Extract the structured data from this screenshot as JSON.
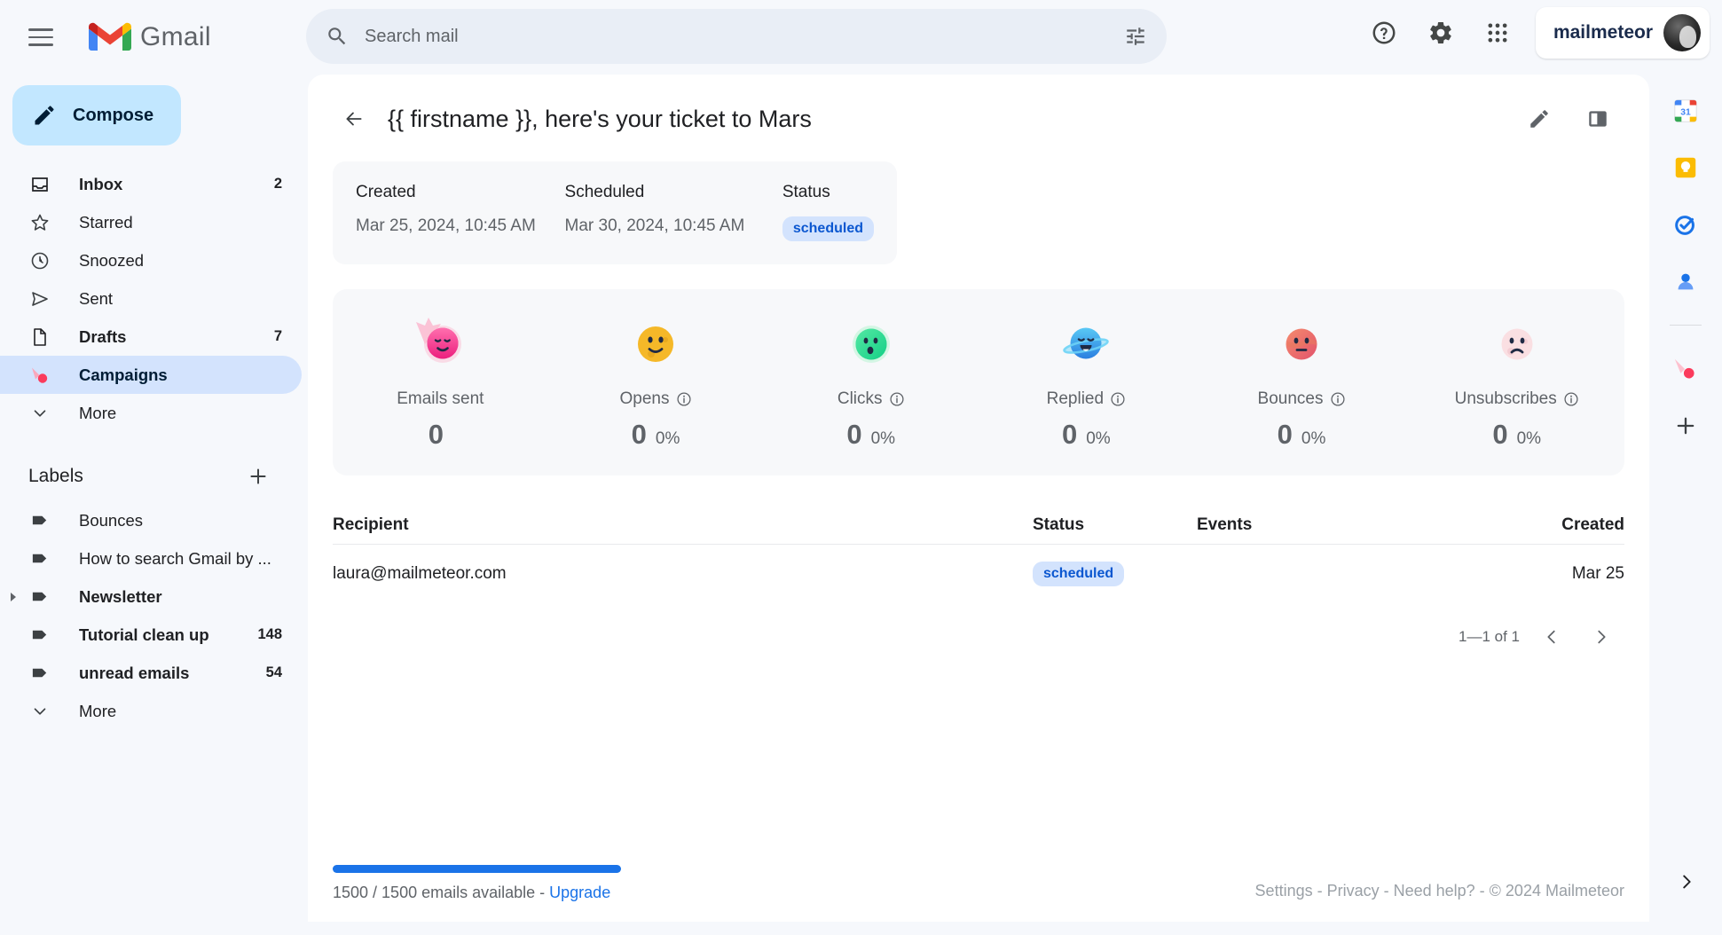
{
  "topbar": {
    "menu_icon": "hamburger-menu-icon",
    "brand": "Gmail",
    "search_placeholder": "Search mail",
    "search_value": "",
    "search_icon": "search-icon",
    "filter_icon": "tune-filter-icon",
    "help_icon": "help-circle-icon",
    "settings_icon": "gear-icon",
    "apps_icon": "apps-grid-icon",
    "account_name": "mailmeteor",
    "avatar_icon": "user-avatar"
  },
  "sidebar": {
    "compose_label": "Compose",
    "compose_icon": "pencil-icon",
    "nav": [
      {
        "label": "Inbox",
        "count": "2",
        "icon": "inbox-icon",
        "bold": true,
        "active": false
      },
      {
        "label": "Starred",
        "count": "",
        "icon": "star-icon",
        "bold": false,
        "active": false
      },
      {
        "label": "Snoozed",
        "count": "",
        "icon": "clock-icon",
        "bold": false,
        "active": false
      },
      {
        "label": "Sent",
        "count": "",
        "icon": "send-icon",
        "bold": false,
        "active": false
      },
      {
        "label": "Drafts",
        "count": "7",
        "icon": "document-icon",
        "bold": true,
        "active": false
      },
      {
        "label": "Campaigns",
        "count": "",
        "icon": "comet-icon",
        "bold": true,
        "active": true
      },
      {
        "label": "More",
        "count": "",
        "icon": "chevron-down-icon",
        "bold": false,
        "active": false
      }
    ],
    "labels_title": "Labels",
    "add_label_icon": "plus-icon",
    "labels": [
      {
        "label": "Bounces",
        "count": "",
        "bold": false,
        "expandable": false
      },
      {
        "label": "How to search Gmail by ...",
        "count": "",
        "bold": false,
        "expandable": false
      },
      {
        "label": "Newsletter",
        "count": "",
        "bold": true,
        "expandable": true
      },
      {
        "label": "Tutorial clean up",
        "count": "148",
        "bold": true,
        "expandable": false
      },
      {
        "label": "unread emails",
        "count": "54",
        "bold": true,
        "expandable": false
      }
    ],
    "labels_more": "More",
    "labels_more_icon": "chevron-down-icon"
  },
  "campaign": {
    "back_icon": "back-arrow-icon",
    "title": "{{ firstname }}, here's your ticket to Mars",
    "edit_icon": "pencil-icon",
    "layout_icon": "split-pane-icon",
    "meta": {
      "created_label": "Created",
      "created_value": "Mar 25, 2024, 10:45 AM",
      "scheduled_label": "Scheduled",
      "scheduled_value": "Mar 30, 2024, 10:45 AM",
      "status_label": "Status",
      "status_value": "scheduled"
    },
    "stats": [
      {
        "label": "Emails sent",
        "value": "0",
        "percent": "",
        "info": false,
        "emoji": "comet-face-pink"
      },
      {
        "label": "Opens",
        "value": "0",
        "percent": "0%",
        "info": true,
        "emoji": "smiley-yellow"
      },
      {
        "label": "Clicks",
        "value": "0",
        "percent": "0%",
        "info": true,
        "emoji": "surprised-green"
      },
      {
        "label": "Replied",
        "value": "0",
        "percent": "0%",
        "info": true,
        "emoji": "planet-blue"
      },
      {
        "label": "Bounces",
        "value": "0",
        "percent": "0%",
        "info": true,
        "emoji": "neutral-red"
      },
      {
        "label": "Unsubscribes",
        "value": "0",
        "percent": "0%",
        "info": true,
        "emoji": "sad-pink"
      }
    ],
    "table": {
      "headers": {
        "recipient": "Recipient",
        "status": "Status",
        "events": "Events",
        "created": "Created"
      },
      "rows": [
        {
          "recipient": "laura@mailmeteor.com",
          "status": "scheduled",
          "events": "",
          "created": "Mar 25"
        }
      ],
      "pager_text": "1—1 of 1",
      "prev_icon": "chevron-left-icon",
      "next_icon": "chevron-right-icon"
    }
  },
  "footer": {
    "quota_prefix": "1500 / 1500 emails available - ",
    "upgrade_label": "Upgrade",
    "progress_percent": 100,
    "links": "Settings - Privacy - Need help? - © 2024 Mailmeteor"
  },
  "rail": {
    "items": [
      {
        "icon": "google-calendar-icon"
      },
      {
        "icon": "google-keep-icon"
      },
      {
        "icon": "google-tasks-icon"
      },
      {
        "icon": "google-contacts-icon"
      }
    ],
    "addon_icon": "mailmeteor-comet-icon",
    "add_icon": "plus-icon",
    "expand_icon": "chevron-right-icon"
  },
  "colors": {
    "accent_blue": "#1a73e8",
    "badge_bg": "#d3e3fd",
    "badge_text": "#0b57d0",
    "compose_bg": "#c2e7ff",
    "page_bg": "#f6f8fc",
    "card_bg": "#f7f8fa"
  }
}
